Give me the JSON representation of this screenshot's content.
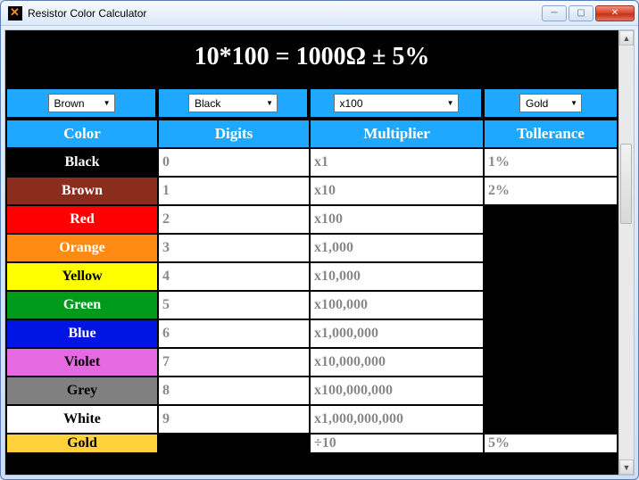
{
  "window": {
    "title": "Resistor Color Calculator"
  },
  "result": "10*100 = 1000Ω ± 5%",
  "selectors": {
    "band1": "Brown",
    "band2": "Black",
    "multiplier": "x100",
    "tolerance": "Gold"
  },
  "headers": {
    "color": "Color",
    "digits": "Digits",
    "multiplier": "Multiplier",
    "tolerance": "Tollerance"
  },
  "rows": [
    {
      "name": "Black",
      "bg": "#000000",
      "fg": "#ffffff",
      "digit": "0",
      "mult": "x1",
      "tol": "1%"
    },
    {
      "name": "Brown",
      "bg": "#8a2d1d",
      "fg": "#ffffff",
      "digit": "1",
      "mult": "x10",
      "tol": "2%"
    },
    {
      "name": "Red",
      "bg": "#ff0000",
      "fg": "#ffffff",
      "digit": "2",
      "mult": "x100",
      "tol": ""
    },
    {
      "name": "Orange",
      "bg": "#ff8a14",
      "fg": "#ffffff",
      "digit": "3",
      "mult": "x1,000",
      "tol": ""
    },
    {
      "name": "Yellow",
      "bg": "#ffff00",
      "fg": "#000000",
      "digit": "4",
      "mult": "x10,000",
      "tol": ""
    },
    {
      "name": "Green",
      "bg": "#009a1a",
      "fg": "#ffffff",
      "digit": "5",
      "mult": "x100,000",
      "tol": ""
    },
    {
      "name": "Blue",
      "bg": "#0015e4",
      "fg": "#ffffff",
      "digit": "6",
      "mult": "x1,000,000",
      "tol": ""
    },
    {
      "name": "Violet",
      "bg": "#e569e0",
      "fg": "#000000",
      "digit": "7",
      "mult": "x10,000,000",
      "tol": ""
    },
    {
      "name": "Grey",
      "bg": "#808080",
      "fg": "#000000",
      "digit": "8",
      "mult": "x100,000,000",
      "tol": ""
    },
    {
      "name": "White",
      "bg": "#ffffff",
      "fg": "#000000",
      "digit": "9",
      "mult": "x1,000,000,000",
      "tol": ""
    },
    {
      "name": "Gold",
      "bg": "#ffd23b",
      "fg": "#000000",
      "digit": "",
      "mult": "÷10",
      "tol": "5%"
    }
  ]
}
